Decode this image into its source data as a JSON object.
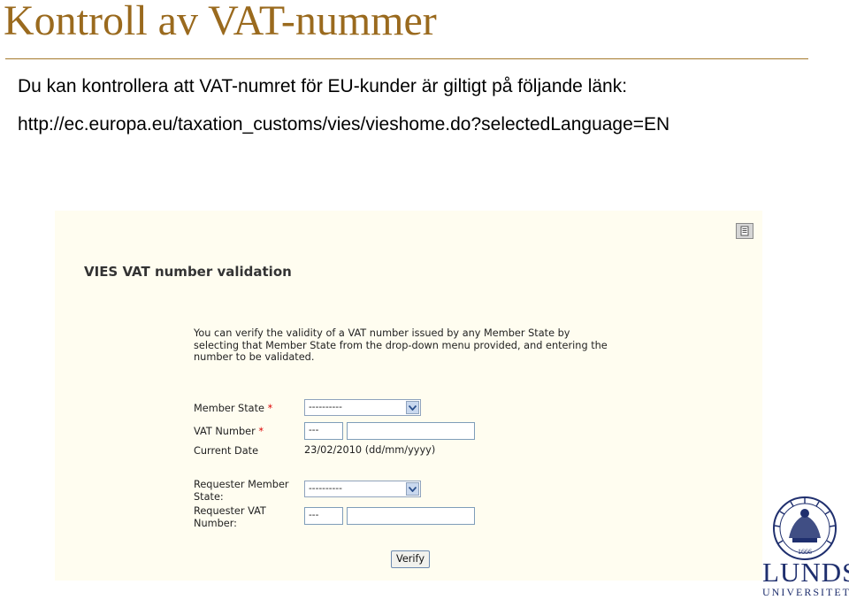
{
  "slide": {
    "title": "Kontroll av VAT-nummer",
    "intro": "Du kan kontrollera att VAT-numret för EU-kunder är giltigt på följande länk:",
    "link": "http://ec.europa.eu/taxation_customs/vies/vieshome.do?selectedLanguage=EN",
    "title_color": "#9a6a1e"
  },
  "vies": {
    "title": "VIES VAT number validation",
    "description_lines": [
      "You can verify the validity of a VAT number issued by any Member State by",
      "selecting that Member State from the drop-down menu provided, and entering the",
      "number to be validated."
    ],
    "print_icon": "print-icon",
    "form": {
      "member_state_label": "Member State",
      "member_state_value": "----------",
      "vat_number_label": "VAT Number",
      "vat_prefix": "---",
      "vat_value": "",
      "current_date_label": "Current Date",
      "current_date_value": "23/02/2010 (dd/mm/yyyy)",
      "requester_member_state_label_1": "Requester Member",
      "requester_member_state_label_2": "State:",
      "requester_member_state_value": "----------",
      "requester_vat_label_1": "Requester VAT",
      "requester_vat_label_2": "Number:",
      "requester_vat_prefix": "---",
      "requester_vat_value": "",
      "required_mark": "*",
      "verify_label": "Verify"
    }
  },
  "logo": {
    "name_line1": "LUNDS",
    "name_line2": "UNIVERSITET",
    "seal_year": "1666",
    "color": "#1f2f6e"
  }
}
